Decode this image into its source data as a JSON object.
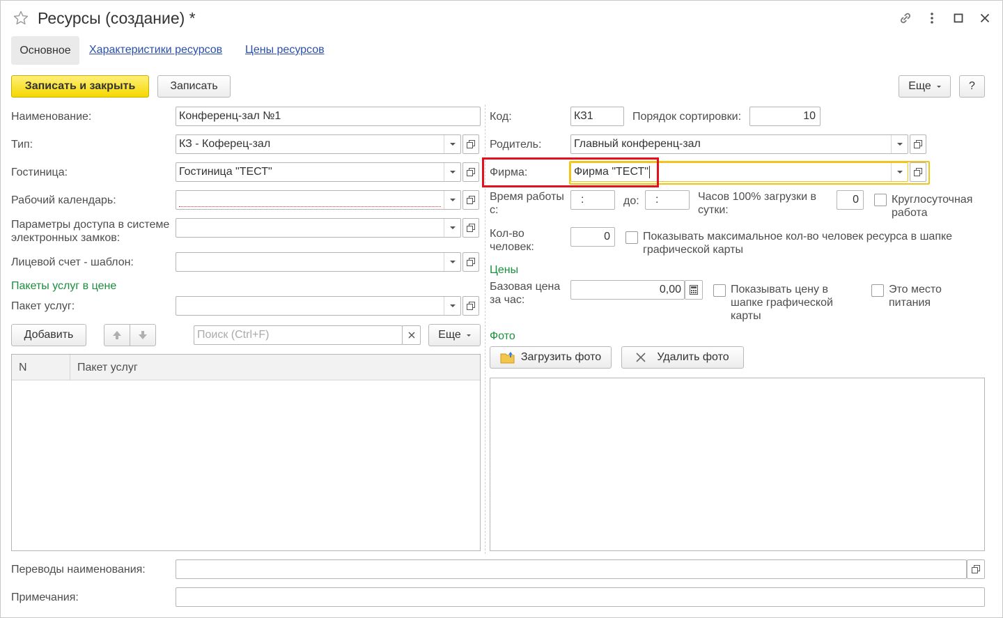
{
  "window": {
    "title": "Ресурсы (создание) *"
  },
  "tabs": {
    "main": "Основное",
    "characteristics": "Характеристики ресурсов",
    "prices": "Цены ресурсов"
  },
  "toolbar": {
    "save_close": "Записать и закрыть",
    "save": "Записать",
    "more": "Еще",
    "help": "?"
  },
  "left": {
    "name_label": "Наименование:",
    "name_value": "Конференц-зал №1",
    "type_label": "Тип:",
    "type_value": "КЗ - Коферец-зал",
    "hotel_label": "Гостиница:",
    "hotel_value": "Гостиница \"ТЕСТ\"",
    "calendar_label": "Рабочий календарь:",
    "calendar_value": "",
    "locks_label": "Параметры доступа в системе электронных замков:",
    "locks_value": "",
    "account_label": "Лицевой счет - шаблон:",
    "account_value": "",
    "packages_section": "Пакеты услуг в цене",
    "package_label": "Пакет услуг:",
    "package_value": "",
    "add_button": "Добавить",
    "search_placeholder": "Поиск (Ctrl+F)",
    "more": "Еще",
    "table": {
      "columns": [
        "N",
        "Пакет услуг"
      ],
      "rows": []
    }
  },
  "right": {
    "code_label": "Код:",
    "code_value": "КЗ1",
    "sort_label": "Порядок сортировки:",
    "sort_value": "10",
    "parent_label": "Родитель:",
    "parent_value": "Главный конференц-зал",
    "firm_label": "Фирма:",
    "firm_value": "Фирма \"ТЕСТ\"",
    "worktime_label": "Время работы с:",
    "time_from": ":",
    "to_label": "до:",
    "time_to": ":",
    "hours_label": "Часов 100% загрузки в сутки:",
    "hours_value": "0",
    "roundclock_label": "Круглосуточная работа",
    "people_label": "Кол-во человек:",
    "people_value": "0",
    "show_max_label": "Показывать максимальное кол-во человек ресурса в шапке графической карты",
    "prices_section": "Цены",
    "base_price_label": "Базовая цена за час:",
    "base_price_value": "0,00",
    "show_price_label": "Показывать цену в шапке графической карты",
    "food_label": "Это место питания",
    "photo_section": "Фото",
    "upload_photo": "Загрузить фото",
    "delete_photo": "Удалить фото"
  },
  "bottom": {
    "translations_label": "Переводы наименования:",
    "translations_value": "",
    "notes_label": "Примечания:",
    "notes_value": ""
  },
  "colors": {
    "accent_yellow": "#f5d700",
    "section_green": "#1a8f3c",
    "link_blue": "#2b4fa8",
    "highlight_red": "#e3101e",
    "focus_yellow": "#f0c419"
  }
}
